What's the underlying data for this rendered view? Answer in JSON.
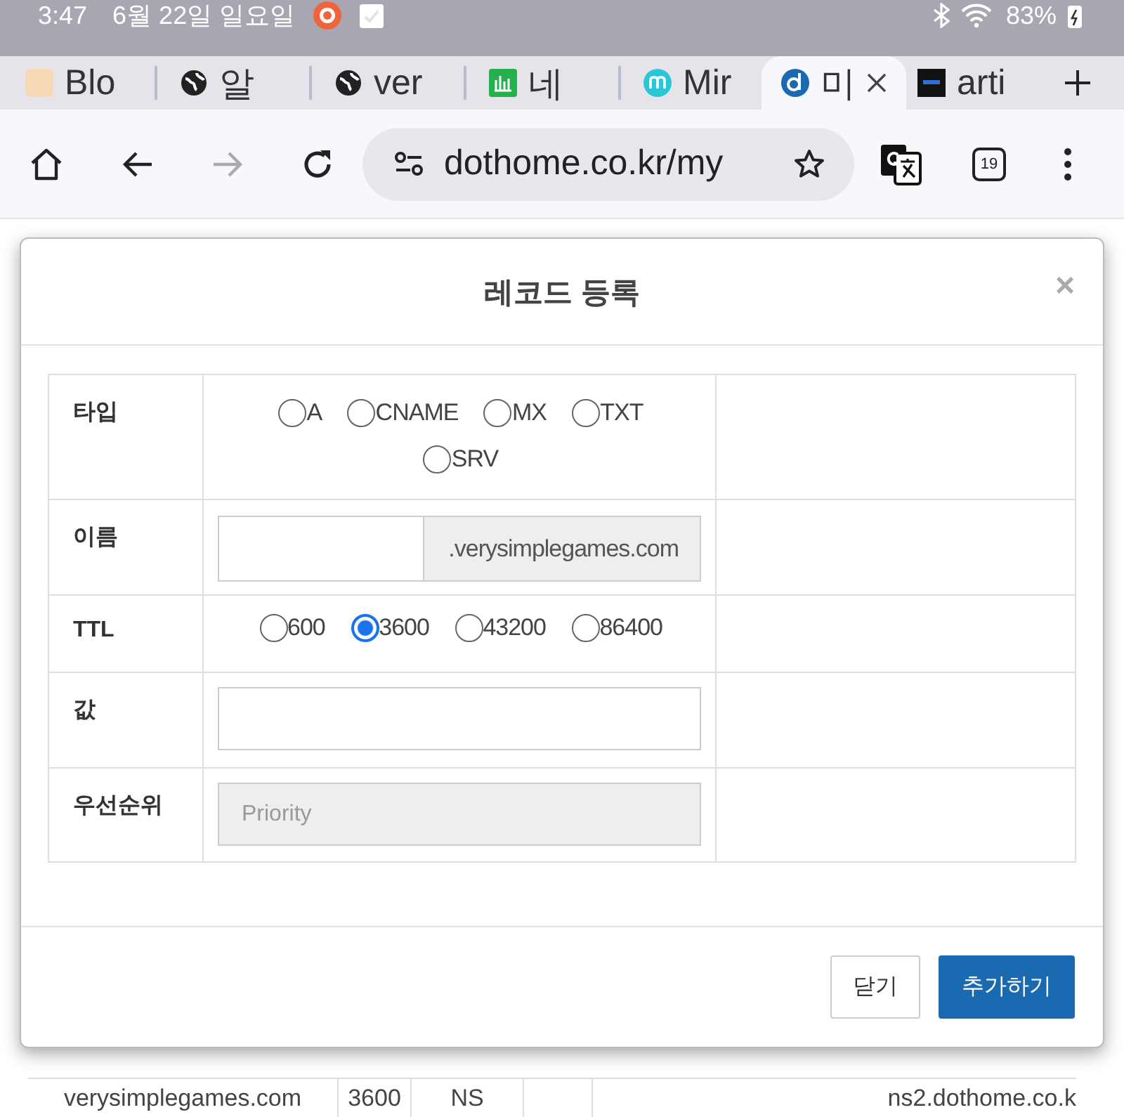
{
  "status_bar": {
    "time": "3:47",
    "date": "6월 22일 일요일",
    "battery": "83%"
  },
  "tabs": [
    {
      "label": "Blo",
      "selected": false
    },
    {
      "label": "알",
      "selected": false
    },
    {
      "label": "ver",
      "selected": false
    },
    {
      "label": "네",
      "selected": false
    },
    {
      "label": "Mir",
      "selected": false
    },
    {
      "label": "미",
      "selected": true
    },
    {
      "label": "arti",
      "selected": false
    }
  ],
  "toolbar": {
    "url": "dothome.co.kr/my",
    "tab_count": "19",
    "forward_disabled": true
  },
  "background_table": {
    "rows": [
      [
        "verysimplegames.com",
        "3600",
        "NS",
        "",
        "ns2.dothome.co.k"
      ]
    ]
  },
  "modal": {
    "title": "레코드 등록",
    "close": "×",
    "rows": [
      {
        "label": "타입",
        "kind": "radio",
        "options": [
          {
            "label": "A",
            "selected": false
          },
          {
            "label": "CNAME",
            "selected": false
          },
          {
            "label": "MX",
            "selected": false
          },
          {
            "label": "TXT",
            "selected": false
          },
          {
            "label": "SRV",
            "selected": false
          }
        ]
      },
      {
        "label": "이름",
        "kind": "name",
        "suffix": ".verysimplegames.com"
      },
      {
        "label": "TTL",
        "kind": "radio",
        "options": [
          {
            "label": "600",
            "selected": false
          },
          {
            "label": "3600",
            "selected": true
          },
          {
            "label": "43200",
            "selected": false
          },
          {
            "label": "86400",
            "selected": false
          }
        ]
      },
      {
        "label": "값",
        "kind": "text"
      },
      {
        "label": "우선순위",
        "kind": "text",
        "placeholder": "Priority",
        "disabled": true
      }
    ],
    "buttons": [
      {
        "label": "닫기",
        "kind": "secondary"
      },
      {
        "label": "추가하기",
        "kind": "primary"
      }
    ]
  }
}
